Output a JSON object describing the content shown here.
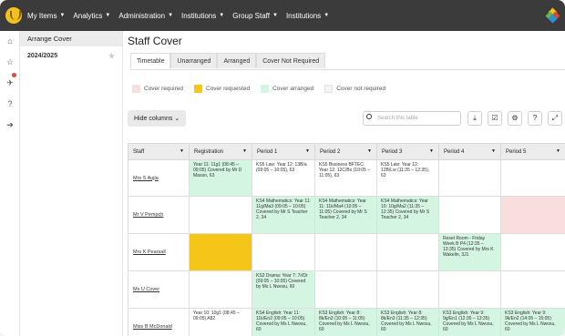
{
  "nav": [
    "My Items",
    "Analytics",
    "Administration",
    "Institutions",
    "Group Staff",
    "Institutions"
  ],
  "sidebar": {
    "heading": "Arrange Cover",
    "year": "2024/2025"
  },
  "page": {
    "title": "Staff Cover"
  },
  "tabs": [
    "Timetable",
    "Unarranged",
    "Arranged",
    "Cover Not Required"
  ],
  "legend": [
    {
      "label": "Cover required",
      "color": "#f9dede"
    },
    {
      "label": "Cover requested",
      "color": "#f5c518"
    },
    {
      "label": "Cover arranged",
      "color": "#d5f5e3"
    },
    {
      "label": "Cover not required",
      "color": "#f4f4f4"
    }
  ],
  "toolbar": {
    "hide_columns": "Hide columns",
    "search_placeholder": "Search this table"
  },
  "grid": {
    "headers": [
      "Staff",
      "Registration",
      "Period 1",
      "Period 2",
      "Period 3",
      "Period 4",
      "Period 5"
    ],
    "rows": [
      {
        "staff": "Mrs S Aujla",
        "cells": [
          {
            "text": "Year 11: 11g1 (08:45 – 09:05) Covered by Mr D Mason, 63",
            "state": "green"
          },
          {
            "text": "KS5 Law: Year 12: 13B/a (09:05 – 10:05), 63",
            "state": ""
          },
          {
            "text": "KS5 Business BFTEC: Year 12: 12C/Bs (10:05 – 11:05), 63",
            "state": ""
          },
          {
            "text": "KS5 Law: Year 12: 12B/Lw (11:35 – 12:35), 63",
            "state": ""
          },
          {
            "text": "",
            "state": ""
          },
          {
            "text": "",
            "state": ""
          }
        ]
      },
      {
        "staff": "Mr V Pempch",
        "cells": [
          {
            "text": "",
            "state": ""
          },
          {
            "text": "KS4 Mathematics: Year 11: 11g/Ma3 (09:05 – 10:05) Covered by Mr S Teacher 2, 34",
            "state": "green"
          },
          {
            "text": "KS4 Mathematics: Year 11: 11k/Ma4 (10:05 – 11:05) Covered by Mr S Teacher 2, 34",
            "state": "green"
          },
          {
            "text": "KS4 Mathematics: Year 10: 10g/Ma2 (11:35 – 12:35) Covered by Mr S Teacher 2, 34",
            "state": "green"
          },
          {
            "text": "",
            "state": ""
          },
          {
            "text": "",
            "state": "pink"
          }
        ]
      },
      {
        "staff": "Mrs K Pearsall",
        "cells": [
          {
            "text": "",
            "state": "yellow"
          },
          {
            "text": "",
            "state": ""
          },
          {
            "text": "",
            "state": ""
          },
          {
            "text": "",
            "state": ""
          },
          {
            "text": "Reset Room - Friday Week B P4 (12:35 – 13:35) Covered by Mrs K Wakelin, 3J1",
            "state": "green"
          },
          {
            "text": "",
            "state": ""
          }
        ]
      },
      {
        "staff": "Ms U Cover",
        "cells": [
          {
            "text": "",
            "state": ""
          },
          {
            "text": "KS3 Drama: Year 7: 7r/Dr (09:05 – 10:05) Covered by Ms L Nwosu, 60",
            "state": "green"
          },
          {
            "text": "",
            "state": ""
          },
          {
            "text": "",
            "state": ""
          },
          {
            "text": "",
            "state": ""
          },
          {
            "text": "",
            "state": ""
          }
        ]
      },
      {
        "staff": "Miss B McDonald",
        "cells": [
          {
            "text": "Year 10: 10g1 (08:45 – 09:05) A82",
            "state": ""
          },
          {
            "text": "KS4 English: Year 11: 11k/En2 (09:05 – 10:05) Covered by Ms L Nwosu, 60",
            "state": "green"
          },
          {
            "text": "KS3 English: Year 8: 8k/En3 (10:05 – 11:05) Covered by Ms L Nwosu, 60",
            "state": "green"
          },
          {
            "text": "KS3 English: Year 8: 8k/En3 (11:35 – 12:35) Covered by Ms L Nwosu, 60",
            "state": "green"
          },
          {
            "text": "KS3 English: Year 9: 9g/En1 (12:35 – 13:35) Covered by Ms L Nwosu, 60",
            "state": "green"
          },
          {
            "text": "KS3 English: Year 9: 9k/En2 (14:05 – 15:05) Covered by Ms L Nwosu, 60",
            "state": "green"
          }
        ]
      }
    ]
  },
  "colors": {
    "topbar": "#3b3b3b",
    "arranged": "#d5f5e3",
    "requested": "#f5c518",
    "required": "#f9dede"
  }
}
